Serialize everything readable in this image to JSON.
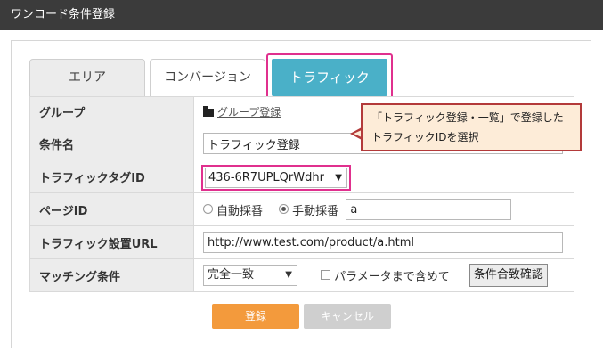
{
  "window": {
    "title": "ワンコード条件登録"
  },
  "tabs": [
    {
      "label": "エリア",
      "active": false
    },
    {
      "label": "コンバージョン",
      "active": false
    },
    {
      "label": "トラフィック",
      "active": true
    }
  ],
  "form": {
    "group": {
      "label": "グループ",
      "link_text": "グループ登録",
      "icon": "folder-icon"
    },
    "condition_name": {
      "label": "条件名",
      "value": "トラフィック登録"
    },
    "traffic_tag": {
      "label": "トラフィックタグID",
      "selected": "436-6R7UPLQrWdhr"
    },
    "page_id": {
      "label": "ページID",
      "radio_auto": "自動採番",
      "radio_manual": "手動採番",
      "selected_option": "手動採番",
      "value": "a"
    },
    "traffic_url": {
      "label": "トラフィック設置URL",
      "value": "http://www.test.com/product/a.html"
    },
    "matching": {
      "label": "マッチング条件",
      "selected": "完全一致",
      "checkbox_label": "パラメータまで含めて",
      "checkbox_checked": false,
      "confirm_button": "条件合致確認"
    }
  },
  "callout": {
    "line1": "「トラフィック登録・一覧」で登録した",
    "line2": "トラフィックIDを選択"
  },
  "actions": {
    "submit": "登録",
    "cancel": "キャンセル"
  },
  "colors": {
    "tab_active": "#4ab0c8",
    "highlight": "#e0308e",
    "submit": "#f39a3c",
    "callout_border": "#b33a3a",
    "callout_bg": "#fdecd8"
  }
}
